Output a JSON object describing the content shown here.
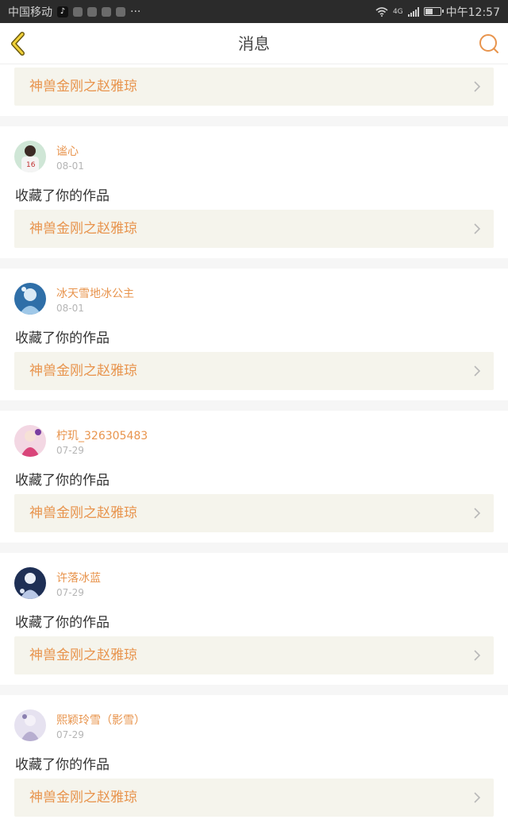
{
  "status_bar": {
    "carrier": "中国移动",
    "time": "中午12:57",
    "network": "4G",
    "battery_level": 0.5
  },
  "header": {
    "title": "消息",
    "back_icon": "back-arrow-icon",
    "search_icon": "search-icon"
  },
  "colors": {
    "accent": "#e8944d",
    "work_bg": "#f5f4ec",
    "date": "#b5b5b5"
  },
  "top_partial": {
    "work_title": "神兽金刚之赵雅琼"
  },
  "messages": [
    {
      "user": "谧心",
      "date": "08-01",
      "action": "收藏了你的作品",
      "work_title": "神兽金刚之赵雅琼"
    },
    {
      "user": "冰天雪地冰公主",
      "date": "08-01",
      "action": "收藏了你的作品",
      "work_title": "神兽金刚之赵雅琼"
    },
    {
      "user": "柠玑_326305483",
      "date": "07-29",
      "action": "收藏了你的作品",
      "work_title": "神兽金刚之赵雅琼"
    },
    {
      "user": "许落冰蓝",
      "date": "07-29",
      "action": "收藏了你的作品",
      "work_title": "神兽金刚之赵雅琼"
    },
    {
      "user": "熙颖玲雪（影雪）",
      "date": "07-29",
      "action": "收藏了你的作品",
      "work_title": "神兽金刚之赵雅琼"
    }
  ]
}
